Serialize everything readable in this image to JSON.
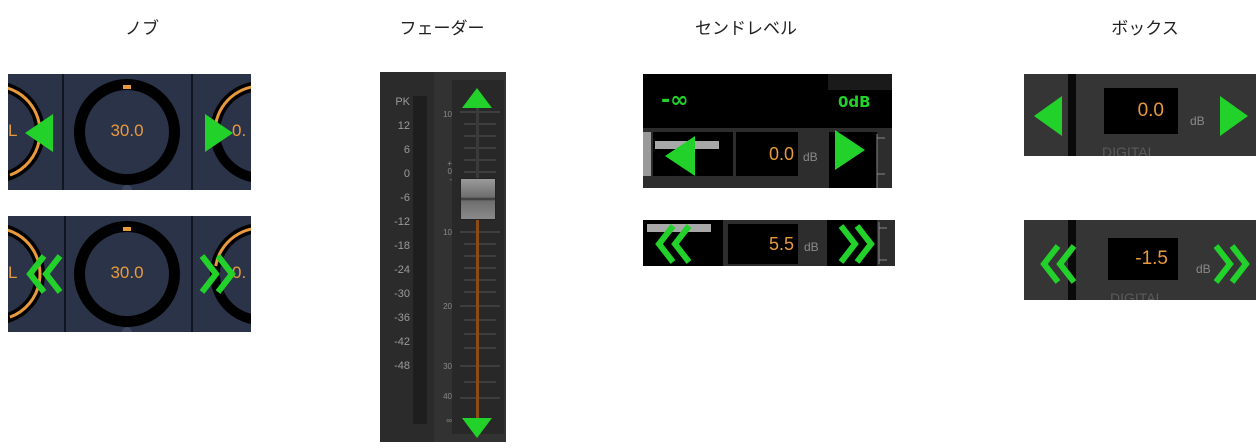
{
  "headings": {
    "knob": "ノブ",
    "fader": "フェーダー",
    "send": "センドレベル",
    "box": "ボックス"
  },
  "knob": {
    "row1": {
      "left_label": "L",
      "value": "30.0",
      "right_label": "0."
    },
    "row2": {
      "left_label": "L",
      "value": "30.0",
      "right_label": "0."
    }
  },
  "fader": {
    "peak_label": "PK",
    "meter_scale": [
      "12",
      "6",
      "0",
      "-6",
      "-12",
      "-18",
      "-24",
      "-30",
      "-36",
      "-42",
      "-48"
    ],
    "fader_scale": [
      "10",
      "+",
      "0",
      "-",
      "10",
      "20",
      "30",
      "40",
      "∞"
    ]
  },
  "send": {
    "neg_inf_label": "-∞",
    "zero_db_label": "0dB",
    "row1": {
      "value": "0.0",
      "unit": "dB"
    },
    "row2": {
      "value": "5.5",
      "unit": "dB"
    }
  },
  "box": {
    "row1": {
      "value": "0.0",
      "unit": "dB",
      "caption": "DIGITAL"
    },
    "row2": {
      "value": "-1.5",
      "unit": "dB",
      "caption": "DIGITAL"
    }
  },
  "colors": {
    "arrow_green": "#22d22a",
    "value_orange": "#e89a3c",
    "knob_bg": "#2b3349"
  },
  "icons": {
    "single_arrow_left": "triangle-left",
    "single_arrow_right": "triangle-right",
    "double_arrow_left": "double-chevron-left",
    "double_arrow_right": "double-chevron-right",
    "arrow_up": "triangle-up",
    "arrow_down": "triangle-down"
  }
}
